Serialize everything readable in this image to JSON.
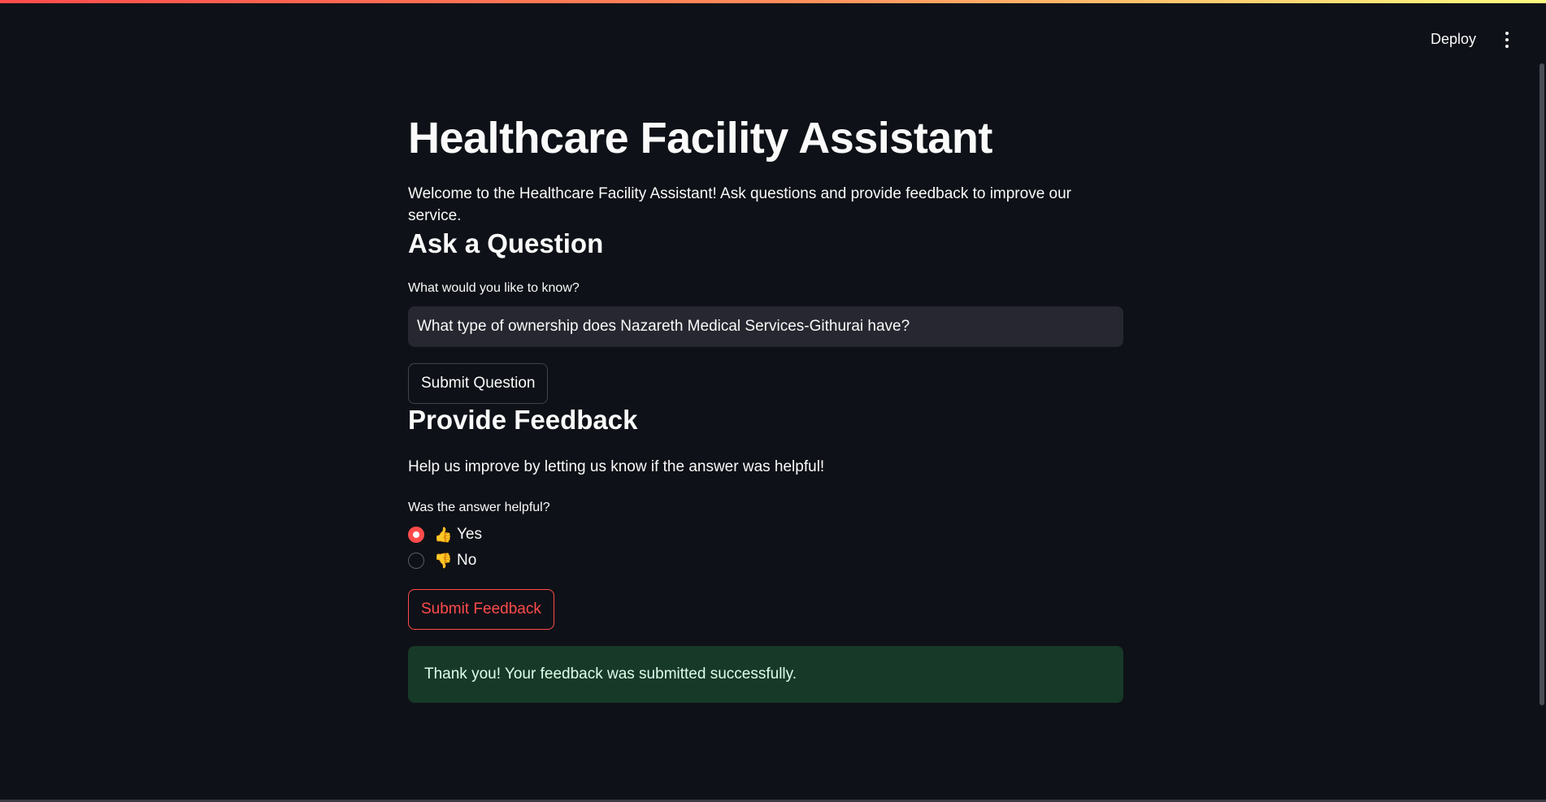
{
  "header": {
    "deploy_label": "Deploy",
    "menu_icon": "vertical-ellipsis-icon"
  },
  "main": {
    "title": "Healthcare Facility Assistant",
    "intro": "Welcome to the Healthcare Facility Assistant! Ask questions and provide feedback to improve our service.",
    "ask_section": {
      "heading": "Ask a Question",
      "input_label": "What would you like to know?",
      "input_value": "What type of ownership does Nazareth Medical Services-Githurai have?",
      "submit_label": "Submit Question"
    },
    "feedback_section": {
      "heading": "Provide Feedback",
      "help_text": "Help us improve by letting us know if the answer was helpful!",
      "radio_label": "Was the answer helpful?",
      "options": [
        {
          "label": "Yes",
          "icon": "thumbs-up-icon",
          "emoji": "👍",
          "selected": true
        },
        {
          "label": "No",
          "icon": "thumbs-down-icon",
          "emoji": "👎",
          "selected": false
        }
      ],
      "submit_label": "Submit Feedback",
      "success_message": "Thank you! Your feedback was submitted successfully."
    }
  },
  "colors": {
    "background": "#0e1117",
    "accent": "#ff4b4b",
    "input_bg": "#262730",
    "success_bg": "#173928",
    "success_text": "#dffde9"
  }
}
